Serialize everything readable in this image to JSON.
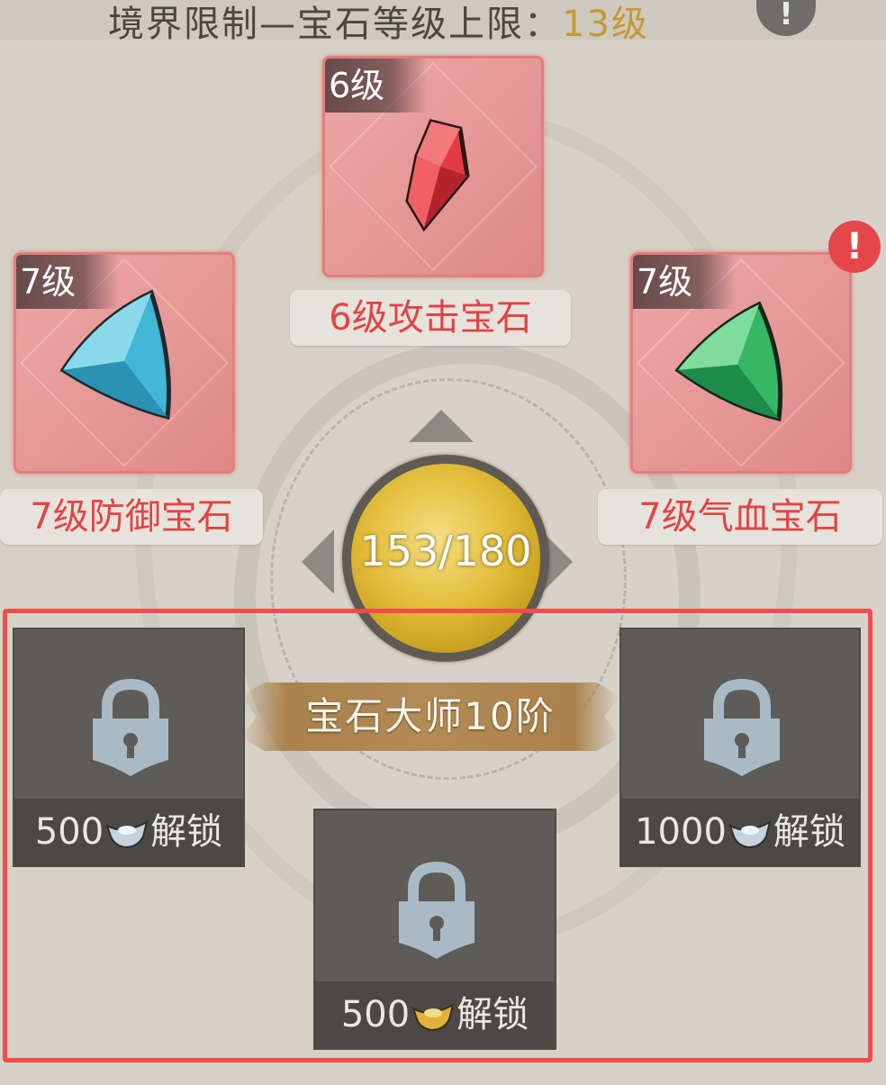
{
  "header": {
    "label": "境界限制—宝石等级上限：",
    "value": "13级"
  },
  "gems": {
    "top": {
      "level": "6级",
      "name": "6级攻击宝石",
      "gem_color": "#d8343c"
    },
    "left": {
      "level": "7级",
      "name": "7级防御宝石",
      "gem_color": "#3fb5cf"
    },
    "right": {
      "level": "7级",
      "name": "7级气血宝石",
      "gem_color": "#2fb260"
    }
  },
  "alert_badge": "!",
  "info_icon": "!",
  "progress": {
    "current": 153,
    "max": 180,
    "text": "153/180"
  },
  "master_title": "宝石大师10阶",
  "locked_slots": {
    "left": {
      "amount": "500",
      "action": "解锁",
      "currency_icon": "silver-ingot-icon"
    },
    "right": {
      "amount": "1000",
      "action": "解锁",
      "currency_icon": "silver-ingot-icon"
    },
    "bottom": {
      "amount": "500",
      "action": "解锁",
      "currency_icon": "gold-ingot-icon"
    }
  },
  "colors": {
    "highlight_frame": "#f04d4d",
    "gem_label_text": "#e04545",
    "header_value": "#c39a35"
  }
}
